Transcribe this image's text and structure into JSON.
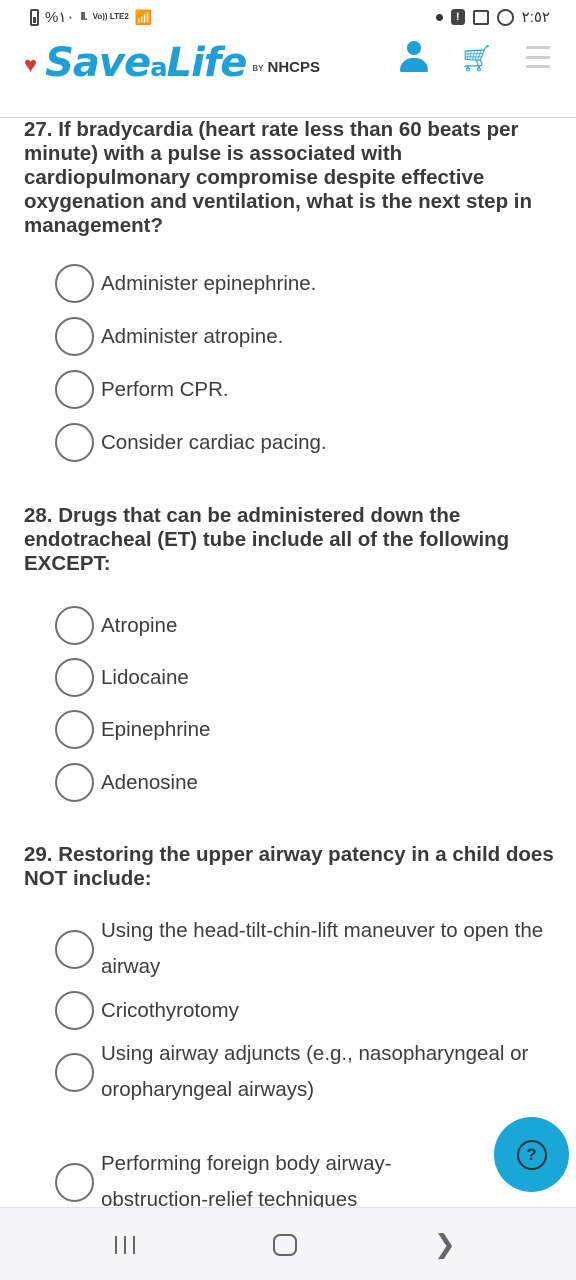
{
  "status_bar": {
    "battery_text": "%١٠",
    "signal_text": "ll.",
    "network_label": "Vo)) LTE2",
    "wifi_icon": "wifi-icon",
    "time": "٢:٥٢"
  },
  "header": {
    "brand_main": "Save",
    "brand_a": "a",
    "brand_life": "Life",
    "by_label": "BY",
    "partner": "NHCPS",
    "accent_color": "#1e9fd9",
    "heart_color": "#d8353b"
  },
  "questions": [
    {
      "text": "27. If bradycardia (heart rate less than 60 beats per minute) with a pulse is associated with cardiopulmonary compromise despite effective oxygenation and ventilation, what is the next step in management?",
      "options": [
        "Administer epinephrine.",
        "Administer atropine.",
        "Perform CPR.",
        "Consider cardiac pacing."
      ]
    },
    {
      "text": "28. Drugs that can be administered down the endotracheal (ET) tube include all of the following EXCEPT:",
      "options": [
        "Atropine",
        "Lidocaine",
        "Epinephrine",
        "Adenosine"
      ]
    },
    {
      "text": "29. Restoring the upper airway patency in a child does NOT include:",
      "options": [
        "Using the head-tilt-chin-lift maneuver to open the airway",
        "Cricothyrotomy",
        "Using airway adjuncts (e.g., nasopharyngeal or oropharyngeal airways)",
        "Performing foreign body airway-obstruction-relief techniques"
      ]
    }
  ],
  "help_button": {
    "glyph": "?"
  }
}
